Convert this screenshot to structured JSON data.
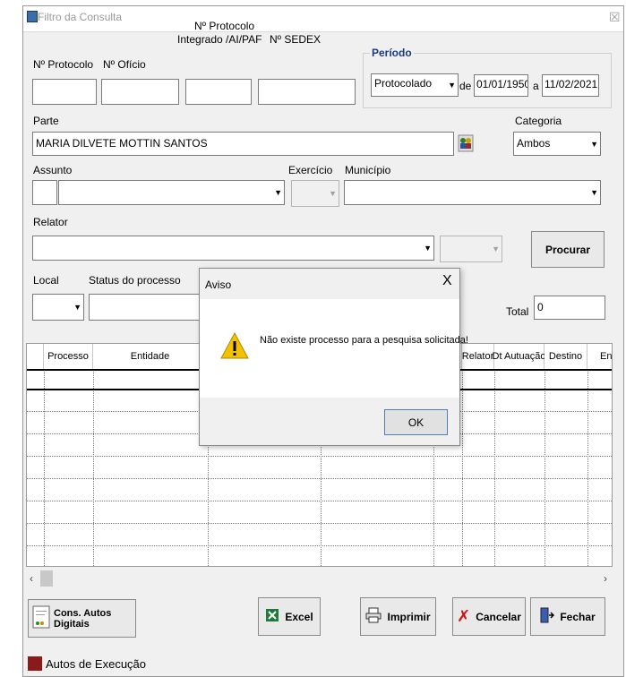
{
  "window": {
    "title": "Filtro da Consulta",
    "close_glyph": "☒"
  },
  "labels": {
    "protocolo": "Nº Protocolo",
    "oficio": "Nº Ofício",
    "protocolo_integrado_line1": "Nº Protocolo",
    "protocolo_integrado_line2": "Integrado /AI/PAF",
    "sedex": "Nº SEDEX",
    "parte": "Parte",
    "categoria": "Categoria",
    "assunto": "Assunto",
    "exercicio": "Exercício",
    "municipio": "Município",
    "relator": "Relator",
    "local": "Local",
    "status": "Status do processo",
    "total": "Total"
  },
  "periodo": {
    "title": "Período",
    "type_value": "Protocolado",
    "de_label": "de",
    "date_from": "01/01/1950",
    "a_label": "a",
    "date_to": "11/02/2021"
  },
  "fields": {
    "parte_value": "MARIA DILVETE MOTTIN SANTOS",
    "categoria_value": "Ambos",
    "total_value": "0"
  },
  "buttons": {
    "procurar": "Procurar",
    "autos_digitais": "Cons. Autos Digitais",
    "excel": "Excel",
    "imprimir": "Imprimir",
    "cancelar": "Cancelar",
    "fechar": "Fechar"
  },
  "grid": {
    "columns": [
      "Processo",
      "Entidade",
      "Relator",
      "Dt Autuação",
      "Destino",
      "En"
    ]
  },
  "legend": {
    "autos_execucao": "Autos de Execução",
    "color": "#8b1a1a"
  },
  "dialog": {
    "title": "Aviso",
    "message": "Não existe processo para a pesquisa solicitada!",
    "ok": "OK",
    "close_glyph": "X",
    "icon": "warning-icon"
  },
  "colors": {
    "periodo_title": "#1a3a8a",
    "warning": "#f2c200"
  }
}
